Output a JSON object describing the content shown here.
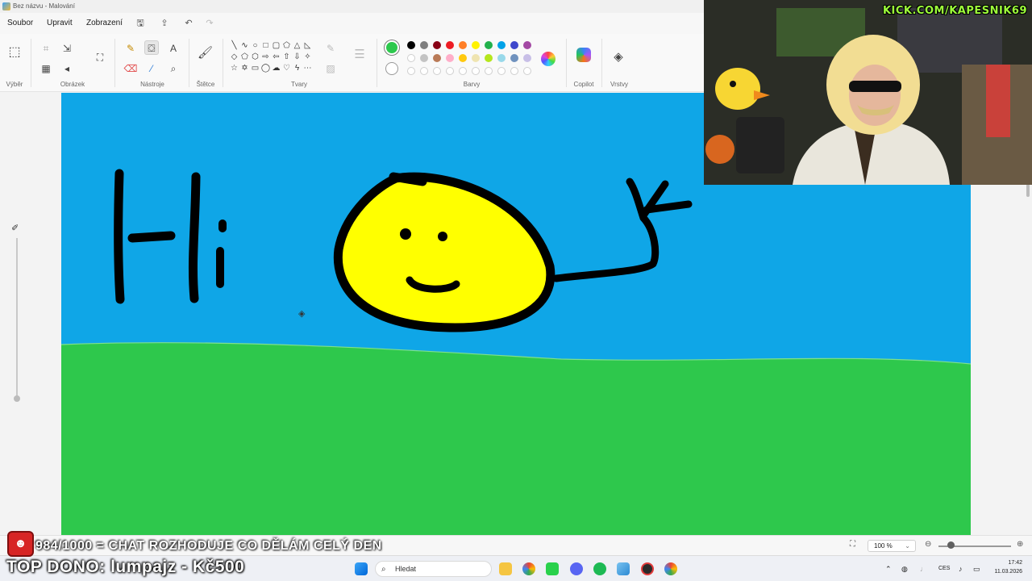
{
  "window": {
    "title": "Bez názvu - Malování"
  },
  "menu": {
    "file": "Soubor",
    "edit": "Upravit",
    "view": "Zobrazení"
  },
  "ribbon": {
    "groups": {
      "selection": "Výběr",
      "image": "Obrázek",
      "tools": "Nástroje",
      "brushes": "Štětce",
      "shapes": "Tvary",
      "colors": "Barvy",
      "copilot": "Copilot",
      "layers": "Vrstvy"
    },
    "current_color": "#2dc84d",
    "secondary_color": "#ffffff",
    "palette_row1": [
      "#000000",
      "#7f7f7f",
      "#880015",
      "#ed1c24",
      "#ff7f27",
      "#fff200",
      "#22b14c",
      "#00a2e8",
      "#3f48cc",
      "#a349a4"
    ],
    "palette_row2": [
      "#ffffff",
      "#c3c3c3",
      "#b97a57",
      "#ffaec9",
      "#ffc90e",
      "#efe4b0",
      "#b5e61d",
      "#99d9ea",
      "#7092be",
      "#c8bfe7"
    ]
  },
  "canvas": {
    "sky_color": "#0fa6e7",
    "grass_color": "#2ec84c",
    "sun_color": "#ffff00",
    "drawing_text": "Hi"
  },
  "statusbar": {
    "zoom": "100 %"
  },
  "taskbar": {
    "search_placeholder": "Hledat",
    "language": "CES",
    "time": "17:42",
    "date": "11.03.2026"
  },
  "overlay": {
    "channel": "KICK.COM/KAPESNIK69",
    "line1": "984/1000 = CHAT ROZHODUJE CO DĚLÁM CELÝ DEN",
    "line2": "TOP DONO: lumpajz - Kč500"
  }
}
